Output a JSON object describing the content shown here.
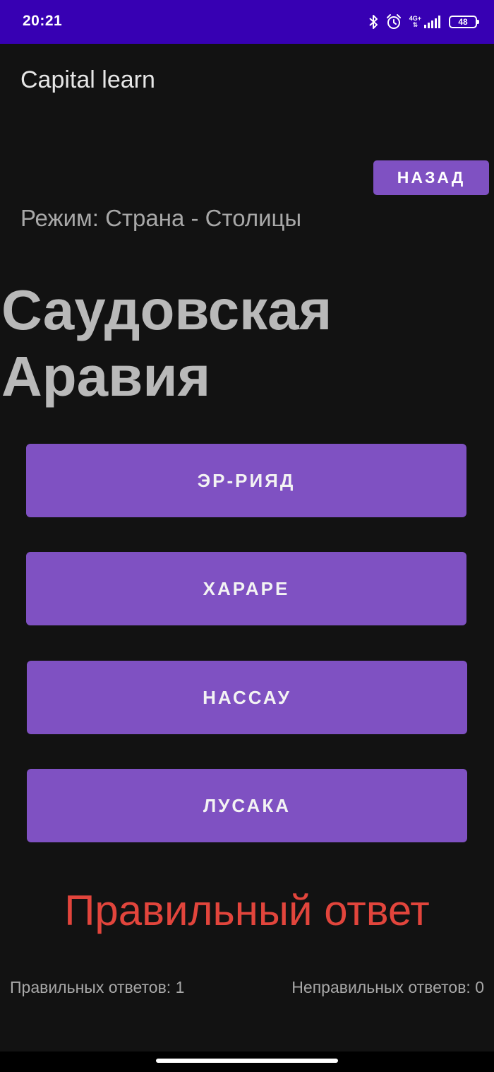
{
  "status_bar": {
    "time": "20:21",
    "network": "4G+",
    "battery": "48",
    "icons": [
      "bluetooth-icon",
      "alarm-icon",
      "signal-icon",
      "battery-icon"
    ]
  },
  "app": {
    "title": "Capital learn"
  },
  "back_button": {
    "label": "НАЗАД"
  },
  "mode": {
    "label": "Режим: Страна - Столицы"
  },
  "question": {
    "country": "Саудовская Аравия"
  },
  "answers": [
    {
      "label": "ЭР-РИЯД"
    },
    {
      "label": "ХАРАРЕ"
    },
    {
      "label": "НАССАУ"
    },
    {
      "label": "ЛУСАКА"
    }
  ],
  "result": {
    "text": "Правильный ответ"
  },
  "stats": {
    "correct": "Правильных ответов: 1",
    "wrong": "Неправильных ответов: 0"
  },
  "colors": {
    "status_bar": "#3700B3",
    "background": "#121212",
    "button": "#7F51C2",
    "result": "#E2453C"
  }
}
